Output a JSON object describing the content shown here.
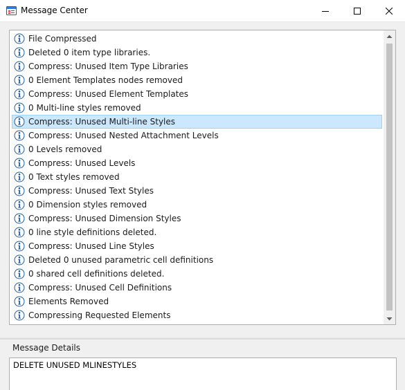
{
  "window": {
    "title": "Message Center",
    "app_icon": "message-center-icon",
    "controls": {
      "minimize_icon": "minimize-icon",
      "maximize_icon": "maximize-icon",
      "close_icon": "close-icon"
    }
  },
  "messages": {
    "icon": "info-icon",
    "selected_index": 6,
    "items": [
      {
        "text": "File Compressed"
      },
      {
        "text": "Deleted 0 item type libraries."
      },
      {
        "text": "Compress: Unused Item Type Libraries"
      },
      {
        "text": "0 Element Templates nodes removed"
      },
      {
        "text": "Compress: Unused Element Templates"
      },
      {
        "text": "0 Multi-line styles removed"
      },
      {
        "text": "Compress: Unused Multi-line Styles"
      },
      {
        "text": "Compress: Unused Nested Attachment Levels"
      },
      {
        "text": "0 Levels removed"
      },
      {
        "text": "Compress: Unused Levels"
      },
      {
        "text": "0 Text styles removed"
      },
      {
        "text": "Compress: Unused Text Styles"
      },
      {
        "text": "0 Dimension styles removed"
      },
      {
        "text": "Compress: Unused Dimension Styles"
      },
      {
        "text": "0 line style definitions deleted."
      },
      {
        "text": "Compress: Unused Line Styles"
      },
      {
        "text": "Deleted 0 unused parametric cell definitions"
      },
      {
        "text": "0 shared cell definitions deleted."
      },
      {
        "text": "Compress: Unused Cell Definitions"
      },
      {
        "text": "Elements Removed"
      },
      {
        "text": "Compressing Requested Elements"
      }
    ]
  },
  "details": {
    "label": "Message Details",
    "text": "DELETE UNUSED MLINESTYLES"
  },
  "colors": {
    "selection_fill": "#cce8ff",
    "selection_border": "#99d1ff",
    "info_icon_blue": "#1e5a9c"
  }
}
